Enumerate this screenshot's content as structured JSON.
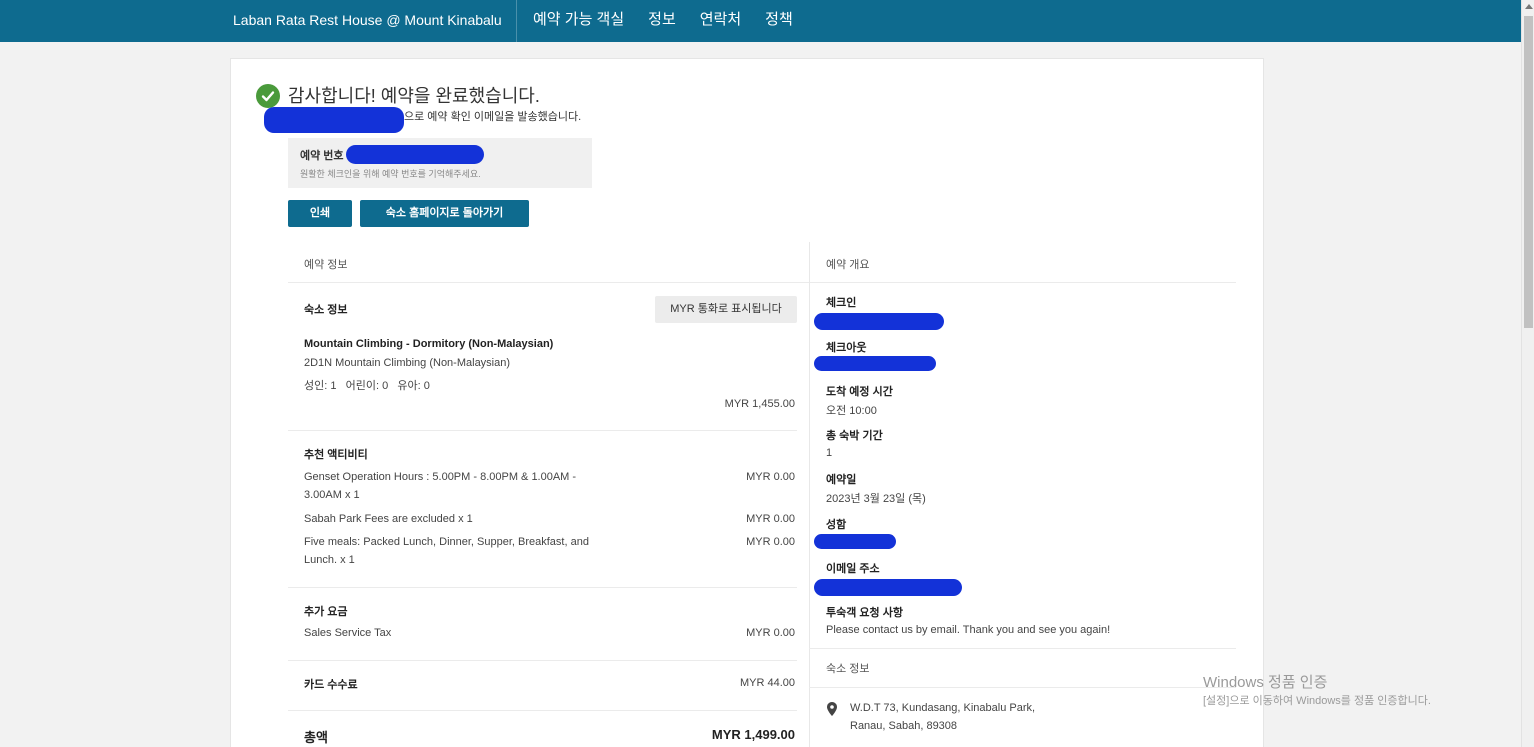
{
  "header": {
    "brand": "Laban Rata Rest House @ Mount Kinabalu",
    "nav": [
      "예약 가능 객실",
      "정보",
      "연락처",
      "정책"
    ]
  },
  "confirmation": {
    "title": "감사합니다! 예약을 완료했습니다.",
    "email_sent": "으로 예약 확인 이메일을 발송했습니다.",
    "ref_label": "예약 번호",
    "ref_hint": "원활한 체크인을 위해 예약 번호를 기억해주세요.",
    "print_button": "인쇄",
    "home_button": "숙소 홈페이지로 돌아가기"
  },
  "booking_info": {
    "section_title": "예약 정보",
    "property_title": "숙소 정보",
    "currency_note": "MYR 통화로 표시됩니다",
    "room_name": "Mountain Climbing - Dormitory (Non-Malaysian)",
    "room_sub": "2D1N Mountain Climbing (Non-Malaysian)",
    "guests": "성인: 1   어린이: 0   유아: 0",
    "room_price": "MYR 1,455.00",
    "activities_title": "추천 액티비티",
    "activities": [
      {
        "name": "Genset Operation Hours : 5.00PM - 8.00PM & 1.00AM - 3.00AM x 1",
        "price": "MYR 0.00"
      },
      {
        "name": "Sabah Park Fees are excluded x 1",
        "price": "MYR 0.00"
      },
      {
        "name": "Five meals: Packed Lunch, Dinner, Supper, Breakfast, and Lunch. x 1",
        "price": "MYR 0.00"
      }
    ],
    "extra_title": "추가 요금",
    "extra_name": "Sales Service Tax",
    "extra_price": "MYR 0.00",
    "card_fee_label": "카드 수수료",
    "card_fee": "MYR 44.00",
    "total_label": "총액",
    "total": "MYR 1,499.00"
  },
  "summary": {
    "section_title": "예약 개요",
    "checkin_label": "체크인",
    "checkout_label": "체크아웃",
    "arrival_label": "도착 예정 시간",
    "arrival_value": "오전 10:00",
    "nights_label": "총 숙박 기간",
    "nights_value": "1",
    "booked_label": "예약일",
    "booked_value": "2023년 3월 23일 (목)",
    "name_label": "성함",
    "email_label": "이메일 주소",
    "request_label": "투숙객 요청 사항",
    "request_value": "Please contact us by email. Thank you and see you again!",
    "property_section": "숙소 정보",
    "address_line1": "W.D.T 73, Kundasang, Kinabalu Park,",
    "address_line2": "Ranau, Sabah, 89308"
  },
  "watermark": {
    "line1": "Windows 정품 인증",
    "line2": "[설정]으로 이동하여 Windows를 정품 인증합니다."
  }
}
